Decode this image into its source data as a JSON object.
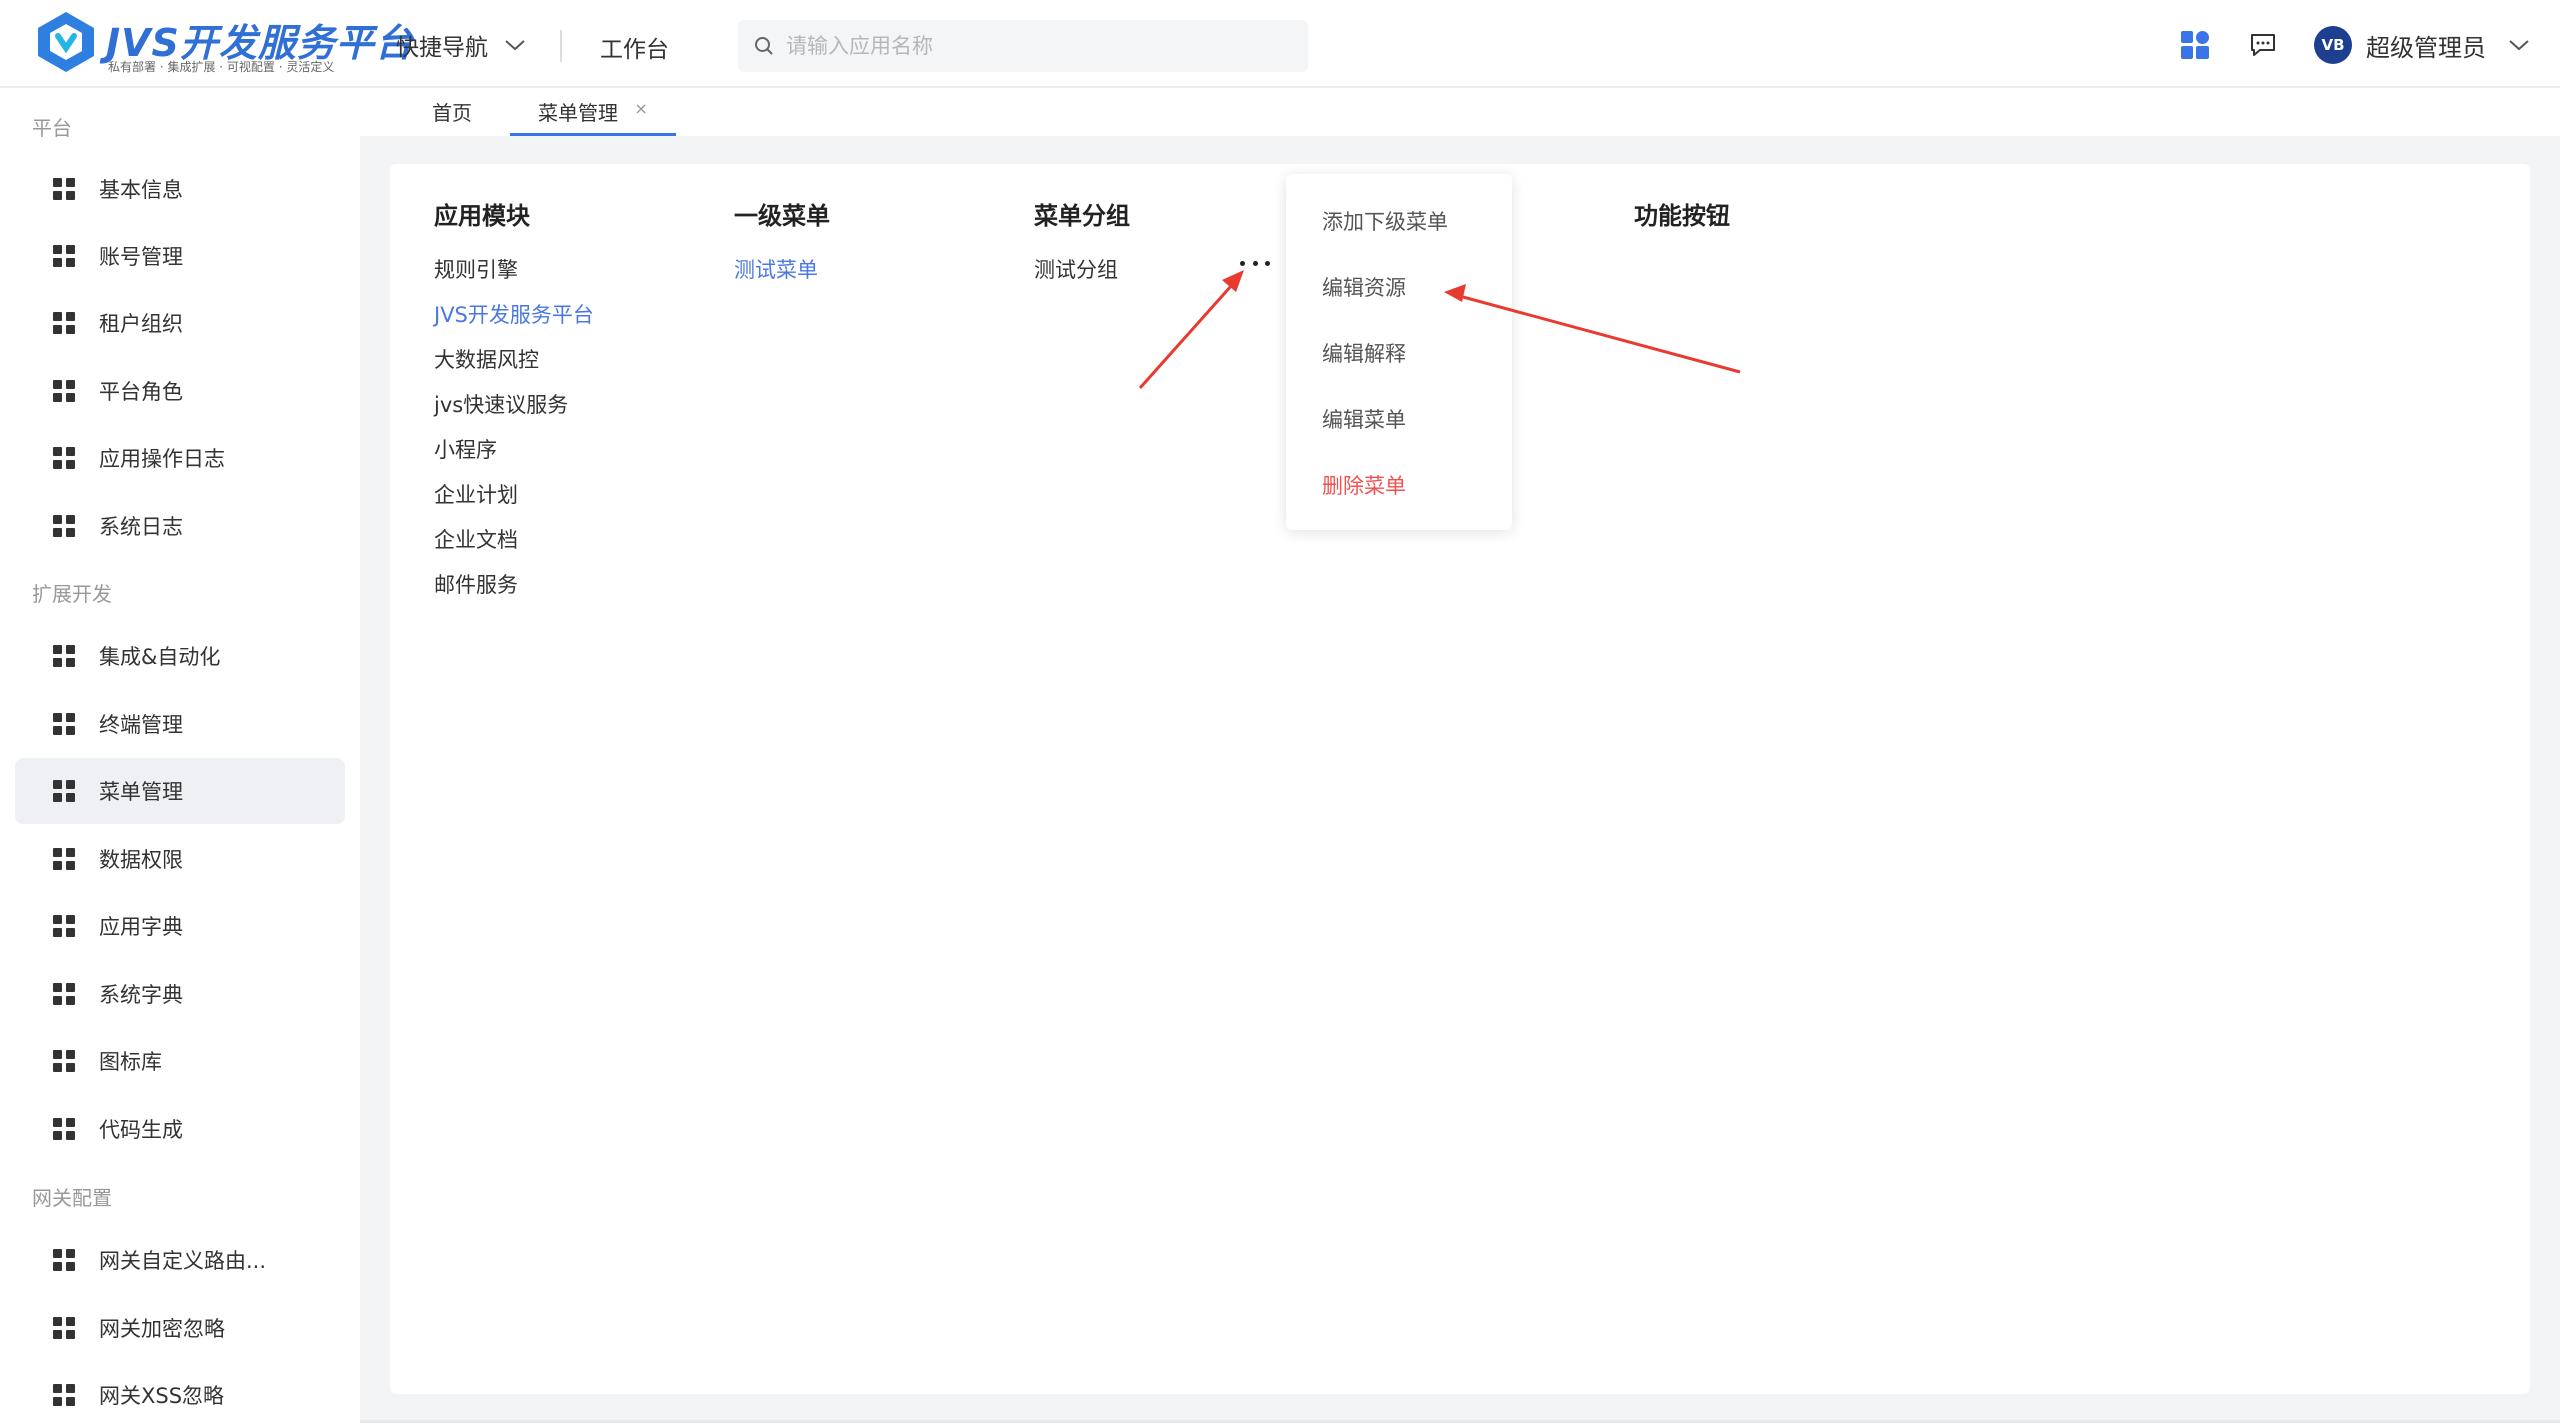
{
  "header": {
    "logo_title": "JVS开发服务平台",
    "logo_subtitle": "私有部署 · 集成扩展 · 可视配置 · 灵活定义",
    "nav_quick": "快捷导航",
    "nav_workbench": "工作台",
    "search_placeholder": "请输入应用名称",
    "avatar_text": "VB",
    "username": "超级管理员",
    "accent_color": "#3b73e8"
  },
  "sidebar": {
    "groups": [
      {
        "label": "平台"
      },
      {
        "label": "扩展开发"
      },
      {
        "label": "网关配置"
      }
    ],
    "items": [
      {
        "label": "基本信息"
      },
      {
        "label": "账号管理"
      },
      {
        "label": "租户组织"
      },
      {
        "label": "平台角色"
      },
      {
        "label": "应用操作日志"
      },
      {
        "label": "系统日志"
      },
      {
        "label": "集成&自动化"
      },
      {
        "label": "终端管理"
      },
      {
        "label": "菜单管理",
        "active": true
      },
      {
        "label": "数据权限"
      },
      {
        "label": "应用字典"
      },
      {
        "label": "系统字典"
      },
      {
        "label": "图标库"
      },
      {
        "label": "代码生成"
      },
      {
        "label": "网关自定义路由..."
      },
      {
        "label": "网关加密忽略"
      },
      {
        "label": "网关XSS忽略"
      }
    ]
  },
  "tabs": [
    {
      "label": "首页"
    },
    {
      "label": "菜单管理",
      "active": true,
      "close": "×"
    }
  ],
  "columns": {
    "app_module": {
      "header": "应用模块",
      "items": [
        "规则引擎",
        "JVS开发服务平台",
        "大数据风控",
        "jvs快速议服务",
        "小程序",
        "企业计划",
        "企业文档",
        "邮件服务"
      ],
      "selected_index": 1
    },
    "level1_menu": {
      "header": "一级菜单",
      "items": [
        "测试菜单"
      ],
      "selected_index": 0
    },
    "menu_group": {
      "header": "菜单分组",
      "items": [
        "测试分组"
      ]
    },
    "function_buttons": {
      "header": "功能按钮"
    }
  },
  "dropdown": {
    "items": [
      {
        "label": "添加下级菜单"
      },
      {
        "label": "编辑资源"
      },
      {
        "label": "编辑解释"
      },
      {
        "label": "编辑菜单"
      },
      {
        "label": "删除菜单",
        "danger": true
      }
    ],
    "danger_color": "#ef5350"
  },
  "annotation_color": "#e83a2f"
}
